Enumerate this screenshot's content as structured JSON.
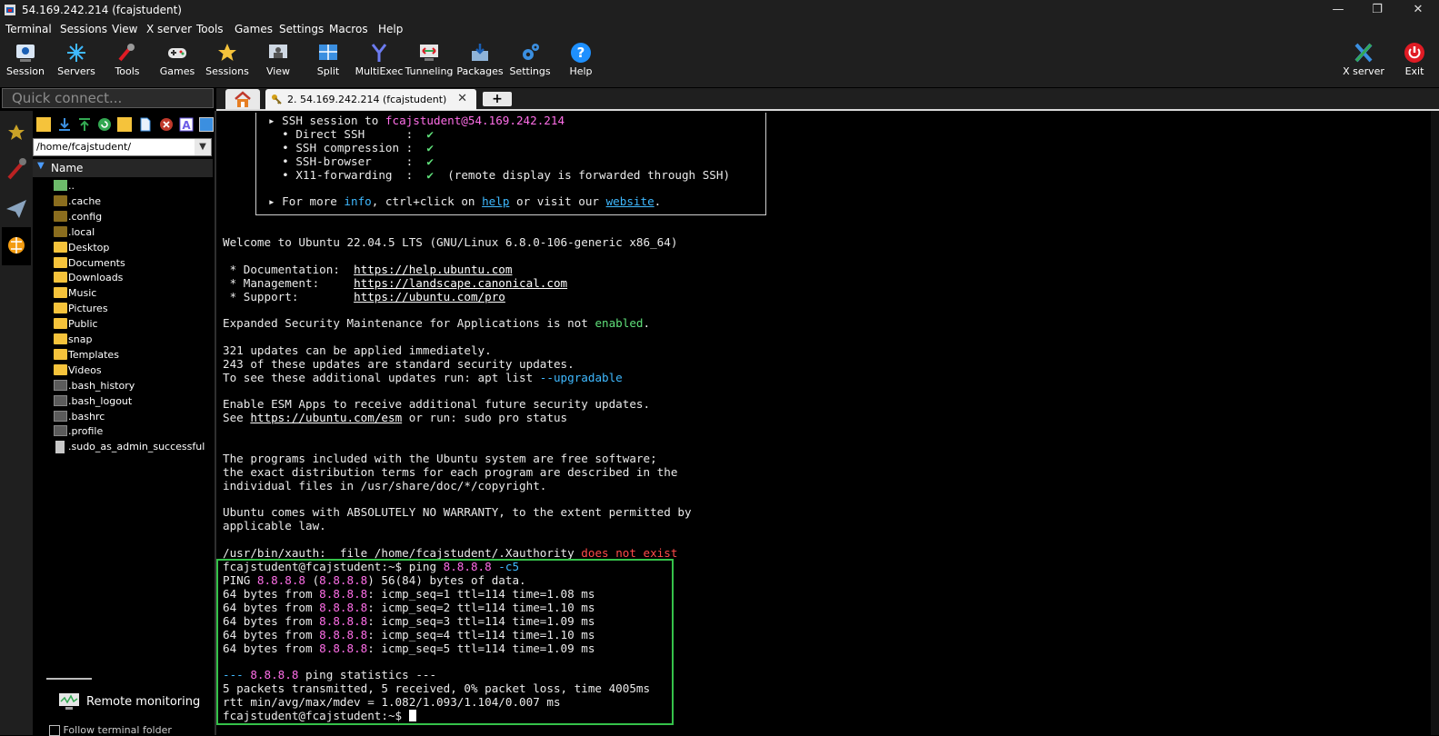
{
  "window": {
    "title": "54.169.242.214 (fcajstudent)",
    "controls": [
      "—",
      "❐",
      "✕"
    ]
  },
  "menu": [
    "Terminal",
    "Sessions",
    "View",
    "X server",
    "Tools",
    "Games",
    "Settings",
    "Macros",
    "Help"
  ],
  "toolbar": {
    "buttons": [
      "Session",
      "Servers",
      "Tools",
      "Games",
      "Sessions",
      "View",
      "Split",
      "MultiExec",
      "Tunneling",
      "Packages",
      "Settings",
      "Help"
    ],
    "right": [
      "X server",
      "Exit"
    ]
  },
  "quick_connect": {
    "placeholder": "Quick connect..."
  },
  "tabs": {
    "session_tab": "2. 54.169.242.214 (fcajstudent)",
    "close": "✕",
    "new": "+"
  },
  "sidebar": {
    "path": "/home/fcajstudent/",
    "column": "Name",
    "files": [
      {
        "name": "..",
        "type": "up"
      },
      {
        "name": ".cache",
        "type": "hfolder"
      },
      {
        "name": ".config",
        "type": "hfolder"
      },
      {
        "name": ".local",
        "type": "hfolder"
      },
      {
        "name": "Desktop",
        "type": "folder"
      },
      {
        "name": "Documents",
        "type": "folder"
      },
      {
        "name": "Downloads",
        "type": "folder"
      },
      {
        "name": "Music",
        "type": "folder"
      },
      {
        "name": "Pictures",
        "type": "folder"
      },
      {
        "name": "Public",
        "type": "folder"
      },
      {
        "name": "snap",
        "type": "folder"
      },
      {
        "name": "Templates",
        "type": "folder"
      },
      {
        "name": "Videos",
        "type": "folder"
      },
      {
        "name": ".bash_history",
        "type": "dim"
      },
      {
        "name": ".bash_logout",
        "type": "dim"
      },
      {
        "name": ".bashrc",
        "type": "dim"
      },
      {
        "name": ".profile",
        "type": "dim"
      },
      {
        "name": ".sudo_as_admin_successful",
        "type": "doc"
      }
    ],
    "remote_monitoring": "Remote monitoring",
    "follow_label": "Follow terminal folder"
  },
  "terminal": {
    "info": {
      "session_prefix": "SSH session to ",
      "session_target": "fcajstudent@54.169.242.214",
      "direct_ssh": "Direct SSH",
      "compression": "SSH compression",
      "browser": "SSH-browser",
      "x11": "X11-forwarding",
      "check": "✔",
      "x11_note": "(remote display is forwarded through SSH)",
      "more_prefix": "For more ",
      "more_info": "info",
      "more_mid": ", ctrl+click on ",
      "more_help": "help",
      "more_mid2": " or visit our ",
      "more_website": "website",
      "more_end": "."
    },
    "welcome": "Welcome to Ubuntu 22.04.5 LTS (GNU/Linux 6.8.0-106-generic x86_64)",
    "doc_label": " * Documentation:  ",
    "doc_url": "https://help.ubuntu.com",
    "mgmt_label": " * Management:     ",
    "mgmt_url": "https://landscape.canonical.com",
    "support_label": " * Support:        ",
    "support_url": "https://ubuntu.com/pro",
    "esm_prefix": "Expanded Security Maintenance for Applications is not ",
    "esm_enabled": "enabled",
    "esm_end": ".",
    "updates1": "321 updates can be applied immediately.",
    "updates2": "243 of these updates are standard security updates.",
    "updates3_prefix": "To see these additional updates run: apt list ",
    "updates3_flag": "--upgradable",
    "esm_apps1": "Enable ESM Apps to receive additional future security updates.",
    "esm_apps2_prefix": "See ",
    "esm_apps2_url": "https://ubuntu.com/esm",
    "esm_apps2_end": " or run: sudo pro status",
    "free1": "The programs included with the Ubuntu system are free software;",
    "free2": "the exact distribution terms for each program are described in the",
    "free3": "individual files in /usr/share/doc/*/copyright.",
    "warranty1": "Ubuntu comes with ABSOLUTELY NO WARRANTY, to the extent permitted by",
    "warranty2": "applicable law.",
    "xauth_prefix": "/usr/bin/xauth:  file /home/fcajstudent/.Xauthority ",
    "xauth_err": "does not exist",
    "prompt": "fcajstudent@fcajstudent:~$ ",
    "cmd": "ping ",
    "cmd_ip": "8.8.8.8",
    "cmd_flag": " -c5",
    "ping_head_a": "PING ",
    "ping_ip": "8.8.8.8",
    "ping_head_b": " (",
    "ping_head_c": ") 56(84) bytes of data.",
    "reply_prefix": "64 bytes from ",
    "replies": [
      ": icmp_seq=1 ttl=114 time=1.08 ms",
      ": icmp_seq=2 ttl=114 time=1.10 ms",
      ": icmp_seq=3 ttl=114 time=1.09 ms",
      ": icmp_seq=4 ttl=114 time=1.10 ms",
      ": icmp_seq=5 ttl=114 time=1.09 ms"
    ],
    "stats_a": "--- ",
    "stats_b": " ping statistics ---",
    "stats_line1": "5 packets transmitted, 5 received, 0% packet loss, time 4005ms",
    "stats_line2": "rtt min/avg/max/mdev = 1.082/1.093/1.104/0.007 ms"
  },
  "colors": {
    "magenta": "#ff6ee8",
    "green": "#5fe07a",
    "cyan": "#3fb9ff",
    "error": "#ff4b4b",
    "highlight_box": "#35c24a"
  }
}
